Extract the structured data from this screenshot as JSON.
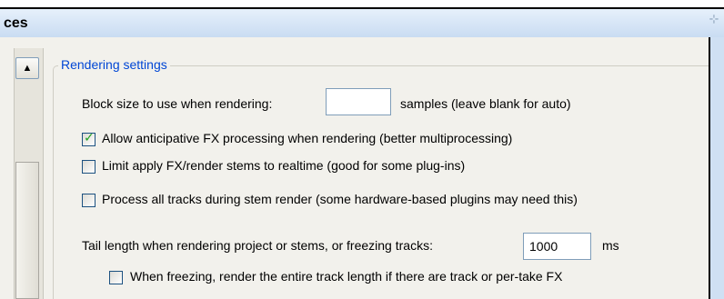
{
  "window": {
    "title": "ces"
  },
  "group": {
    "label": "Rendering settings"
  },
  "block_size": {
    "label": "Block size to use when rendering:",
    "value": "",
    "suffix": "samples (leave blank for auto)"
  },
  "options": [
    {
      "label": "Allow anticipative FX processing when rendering (better multiprocessing)",
      "checked": true
    },
    {
      "label": "Limit apply FX/render stems to realtime (good for some plug-ins)",
      "checked": false
    },
    {
      "label": "Process all tracks during stem render (some hardware-based plugins may need this)",
      "checked": false
    }
  ],
  "tail": {
    "label": "Tail length when rendering project or stems, or freezing tracks:",
    "value": "1000",
    "unit": "ms"
  },
  "freeze_option": {
    "label": "When freezing, render the entire track length if there are track or per-take FX",
    "checked": false
  },
  "icons": {
    "scroll_up": "chevron-up-icon",
    "pin": "pin-icon"
  }
}
